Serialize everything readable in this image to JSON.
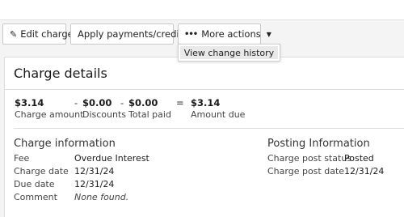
{
  "toolbar": {
    "edit_label": "Edit charge",
    "apply_label": "Apply payments/credits",
    "more_label": "More actions"
  },
  "dropdown": {
    "items": [
      "View change history"
    ]
  },
  "panel": {
    "title": "Charge details"
  },
  "summary": {
    "charge_amount": {
      "value": "$3.14",
      "label": "Charge amount"
    },
    "discounts": {
      "value": "$0.00",
      "label": "Discounts"
    },
    "total_paid": {
      "value": "$0.00",
      "label": "Total paid"
    },
    "amount_due": {
      "value": "$3.14",
      "label": "Amount due"
    },
    "op_minus": "-",
    "op_equals": "="
  },
  "charge_information": {
    "title": "Charge information",
    "rows": [
      {
        "label": "Fee",
        "value": "Overdue Interest"
      },
      {
        "label": "Charge date",
        "value": "12/31/24"
      },
      {
        "label": "Due date",
        "value": "12/31/24"
      },
      {
        "label": "Comment",
        "value": "None found."
      }
    ]
  },
  "posting_information": {
    "title": "Posting Information",
    "rows": [
      {
        "label": "Charge post status",
        "value": "Posted"
      },
      {
        "label": "Charge post date",
        "value": "12/31/24"
      }
    ]
  }
}
